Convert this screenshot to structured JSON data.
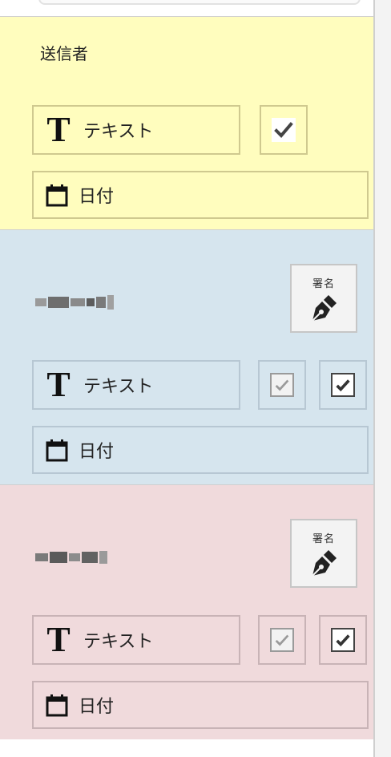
{
  "signers": [
    {
      "name": "送信者",
      "redacted": false,
      "text_field_label": "テキスト",
      "date_field_label": "日付"
    },
    {
      "name": "",
      "redacted": true,
      "sign_label": "署名",
      "text_field_label": "テキスト",
      "date_field_label": "日付"
    },
    {
      "name": "",
      "redacted": true,
      "sign_label": "署名",
      "text_field_label": "テキスト",
      "date_field_label": "日付"
    }
  ],
  "icons": {
    "text": "T",
    "date": "calendar-icon",
    "sign": "pen-nib-icon",
    "check": "checkmark-icon"
  },
  "colors": {
    "sender_bg": "#fffdbe",
    "signer2_bg": "#d6e5ee",
    "signer3_bg": "#f0dadc"
  }
}
